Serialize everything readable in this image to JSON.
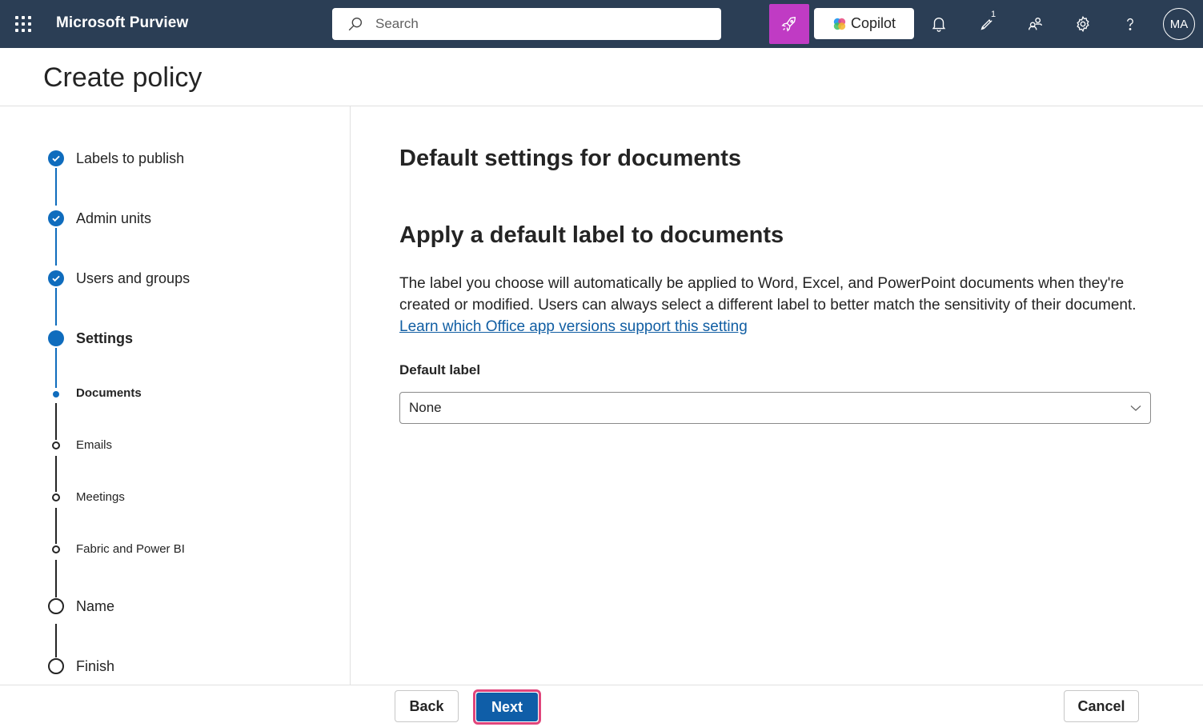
{
  "header": {
    "app_name": "Microsoft Purview",
    "search_placeholder": "Search",
    "copilot_label": "Copilot",
    "notification_count": "1",
    "avatar_initials": "MA",
    "bar_color": "#2b3e55",
    "rocket_color": "#c03bc4"
  },
  "page": {
    "title": "Create policy"
  },
  "steps": [
    {
      "label": "Labels to publish",
      "state": "done"
    },
    {
      "label": "Admin units",
      "state": "done"
    },
    {
      "label": "Users and groups",
      "state": "done"
    },
    {
      "label": "Settings",
      "state": "current"
    },
    {
      "label": "Documents",
      "state": "sub-current"
    },
    {
      "label": "Emails",
      "state": "sub-pending"
    },
    {
      "label": "Meetings",
      "state": "sub-pending"
    },
    {
      "label": "Fabric and Power BI",
      "state": "sub-pending"
    },
    {
      "label": "Name",
      "state": "pending"
    },
    {
      "label": "Finish",
      "state": "pending"
    }
  ],
  "main": {
    "heading": "Default settings for documents",
    "subheading": "Apply a default label to documents",
    "description": "The label you choose will automatically be applied to Word, Excel, and PowerPoint documents when they're created or modified. Users can always select a different label to better match the sensitivity of their document.",
    "link_text": "Learn which Office app versions support this setting",
    "field_label": "Default label",
    "default_label_value": "None"
  },
  "footer": {
    "back_label": "Back",
    "next_label": "Next",
    "cancel_label": "Cancel",
    "accent_color": "#0f5ea8"
  }
}
